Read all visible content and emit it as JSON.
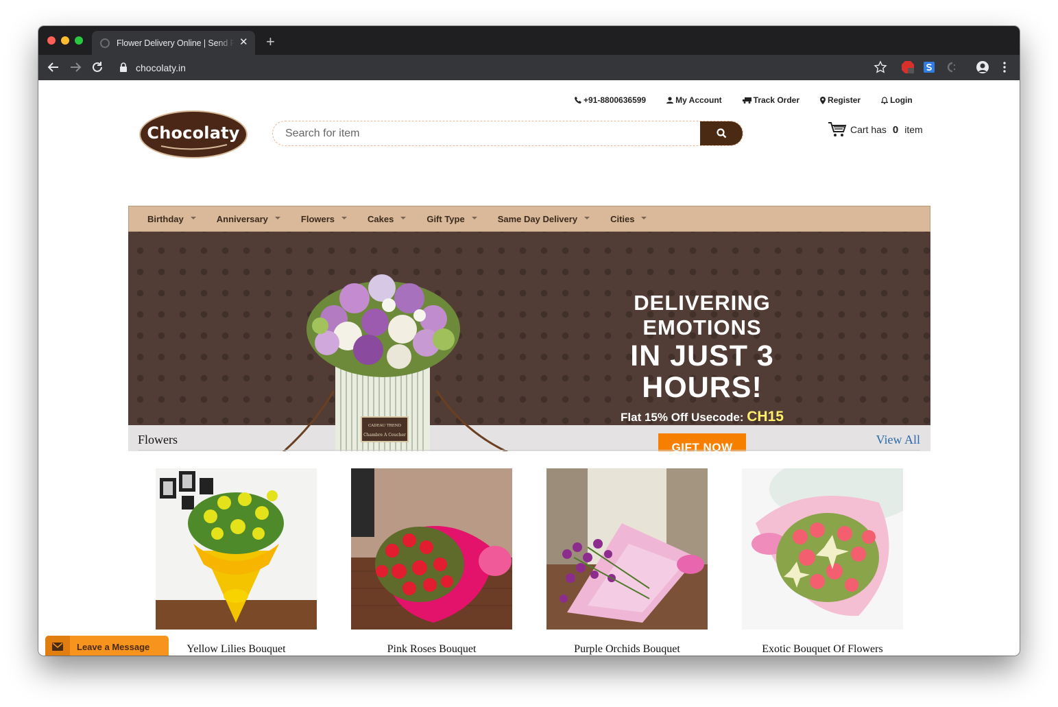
{
  "browser": {
    "tab_title": "Flower Delivery Online | Send Flowers",
    "url": "chocolaty.in",
    "new_tab_symbol": "+",
    "close_symbol": "✕"
  },
  "header": {
    "phone": "+91-8800636599",
    "my_account": "My Account",
    "track_order": "Track Order",
    "register": "Register",
    "login": "Login",
    "logo_text": "Chocolaty",
    "search_placeholder": "Search for item",
    "cart_prefix": "Cart has",
    "cart_count": "0",
    "cart_suffix": "item"
  },
  "nav": {
    "items": [
      "Birthday",
      "Anniversary",
      "Flowers",
      "Cakes",
      "Gift Type",
      "Same Day Delivery",
      "Cities"
    ]
  },
  "hero": {
    "line1": "DELIVERING EMOTIONS",
    "line2": "IN JUST 3 HOURS!",
    "offer_prefix": "Flat 15% Off Usecode:",
    "code": "CH15",
    "button": "GIFT NOW",
    "box_label_1": "CADEAU TREND",
    "box_label_2": "Chambre A Coucher"
  },
  "section": {
    "title": "Flowers",
    "view_all": "View All"
  },
  "products": [
    {
      "name": "Yellow Lilies Bouquet"
    },
    {
      "name": "Pink Roses Bouquet"
    },
    {
      "name": "Purple Orchids Bouquet"
    },
    {
      "name": "Exotic Bouquet Of Flowers"
    }
  ],
  "chat_widget": {
    "label": "Leave a Message"
  },
  "colors": {
    "brand_brown": "#4a2a12",
    "nav_tan": "#d9b999",
    "hero_bg": "#513d36",
    "cta_orange": "#f77f00",
    "code_yellow": "#ffef6a",
    "link_blue": "#2a6aaa"
  }
}
